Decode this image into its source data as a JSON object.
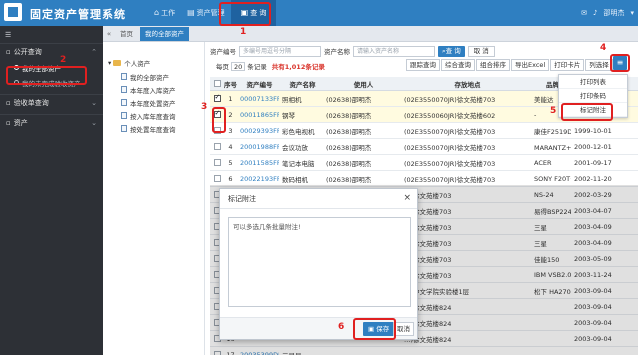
{
  "app": {
    "title": "固定资产管理系统",
    "nav": [
      {
        "label": "工作",
        "icon": "home-icon"
      },
      {
        "label": "资产管理",
        "icon": "asset-icon"
      },
      {
        "label": "查 询",
        "icon": "query-icon"
      }
    ],
    "user": "邵明杰"
  },
  "sidebar": {
    "groups": [
      {
        "label": "公开查询",
        "items": [
          "我的全部资产",
          "我的未完成验收资产"
        ]
      },
      {
        "label": "验收单查询",
        "items": []
      },
      {
        "label": "资产",
        "items": []
      }
    ]
  },
  "tabs": [
    "首页",
    "我的全部资产"
  ],
  "tree": {
    "root": "个人资产",
    "nodes": [
      "我的全部资产",
      "本年度入库资产",
      "本年度处置资产",
      "按入库年度查询",
      "按处置年度查询"
    ]
  },
  "search": {
    "code_label": "资产编号",
    "code_placeholder": "多编号用逗号分隔",
    "name_label": "资产名称",
    "name_placeholder": "请输入资产名称",
    "query_btn": "查 询",
    "cancel_btn": "取 消"
  },
  "toolbar": {
    "per_page_label": "每页",
    "per_page": "20",
    "per_page_unit": "条记录",
    "total_text": "共有1,012条记录",
    "buttons": [
      "跟踪查询",
      "综合查询",
      "组合排序",
      "导出Excel",
      "打印卡片",
      "列选择"
    ],
    "menu_icon": "≡"
  },
  "dropdown": [
    "打印列表",
    "打印条码",
    "标记附注"
  ],
  "table": {
    "headers": [
      "",
      "序号",
      "资产编号",
      "资产名称",
      "使用人",
      "存放地点",
      "品牌",
      ""
    ],
    "rows": [
      {
        "checked": true,
        "no": "1",
        "code": "00007133FF",
        "name": "照相机",
        "user": "(02638)邵明杰",
        "place": "(02E3550070JR)徐文苑楼703",
        "brand": "美能达",
        "date": "",
        "sel": true
      },
      {
        "checked": true,
        "no": "2",
        "code": "00011865FF",
        "name": "钢琴",
        "user": "(02638)邵明杰",
        "place": "(02E3550060JR)徐文苑楼602",
        "brand": "-",
        "date": "",
        "sel": true
      },
      {
        "checked": false,
        "no": "3",
        "code": "00029393FF",
        "name": "彩色电视机",
        "user": "(02638)邵明杰",
        "place": "(02E3550070JR)徐文苑楼703",
        "brand": "康佳F2519D",
        "date": "1999-10-01"
      },
      {
        "checked": false,
        "no": "4",
        "code": "20001988FF",
        "name": "会议功放",
        "user": "(02638)邵明杰",
        "place": "(02E3550070JR)徐文苑楼703",
        "brand": "MARANTZ+连接件",
        "date": "2000-12-01"
      },
      {
        "checked": false,
        "no": "5",
        "code": "20011585FF",
        "name": "笔记本电脑",
        "user": "(02638)邵明杰",
        "place": "(02E3550070JR)徐文苑楼703",
        "brand": "ACER",
        "date": "2001-09-17"
      },
      {
        "checked": false,
        "no": "6",
        "code": "20022193FF",
        "name": "数码相机",
        "user": "(02638)邵明杰",
        "place": "(02E3550070JR)徐文苑楼703",
        "brand": "SONY F20T+128M+FX",
        "date": "2002-11-20"
      },
      {
        "checked": false,
        "no": "7",
        "code": "",
        "name": "",
        "user": "",
        "place": "…)徐文苑楼703",
        "brand": "NS-24",
        "date": "2002-03-29"
      },
      {
        "checked": false,
        "no": "8",
        "code": "",
        "name": "",
        "user": "",
        "place": "…)徐文苑楼703",
        "brand": "易得BSP2240",
        "date": "2003-04-07"
      },
      {
        "checked": false,
        "no": "9",
        "code": "",
        "name": "",
        "user": "",
        "place": "…)徐文苑楼703",
        "brand": "三星",
        "date": "2003-04-09"
      },
      {
        "checked": false,
        "no": "10",
        "code": "",
        "name": "",
        "user": "",
        "place": "…)徐文苑楼703",
        "brand": "三星",
        "date": "2003-04-09"
      },
      {
        "checked": false,
        "no": "11",
        "code": "",
        "name": "",
        "user": "",
        "place": "…)徐文苑楼703",
        "brand": "佳能150",
        "date": "2003-05-09"
      },
      {
        "checked": false,
        "no": "12",
        "code": "",
        "name": "",
        "user": "",
        "place": "…)徐文苑楼703",
        "brand": "IBM VSB2.0 20G",
        "date": "2003-11-24"
      },
      {
        "checked": false,
        "no": "13",
        "code": "",
        "name": "",
        "user": "",
        "place": "…)中文学院实验楼1层",
        "brand": "松下 HA2703FWY",
        "date": "2003-09-04"
      },
      {
        "checked": false,
        "no": "14",
        "code": "",
        "name": "",
        "user": "",
        "place": "…)徐文苑楼824",
        "brand": "",
        "date": "2003-09-04"
      },
      {
        "checked": false,
        "no": "15",
        "code": "",
        "name": "",
        "user": "",
        "place": "…)徐文苑楼824",
        "brand": "",
        "date": "2003-09-04"
      },
      {
        "checked": false,
        "no": "16",
        "code": "",
        "name": "",
        "user": "",
        "place": "…)徐文苑楼824",
        "brand": "",
        "date": "2003-09-04"
      },
      {
        "checked": false,
        "no": "17",
        "code": "20035399DD",
        "name": "三星显",
        "user": "",
        "place": "",
        "brand": "",
        "date": ""
      }
    ]
  },
  "modal": {
    "title": "标记附注",
    "close": "×",
    "text": "可以多选几条批量附注!",
    "save_btn": "保存",
    "cancel_btn": "取消"
  },
  "annotations": [
    "1",
    "2",
    "3",
    "4",
    "5",
    "6"
  ],
  "colors": {
    "primary": "#2f7fc1",
    "sidebar": "#2d3036",
    "annotation": "#e02020",
    "total": "#d9342b"
  }
}
